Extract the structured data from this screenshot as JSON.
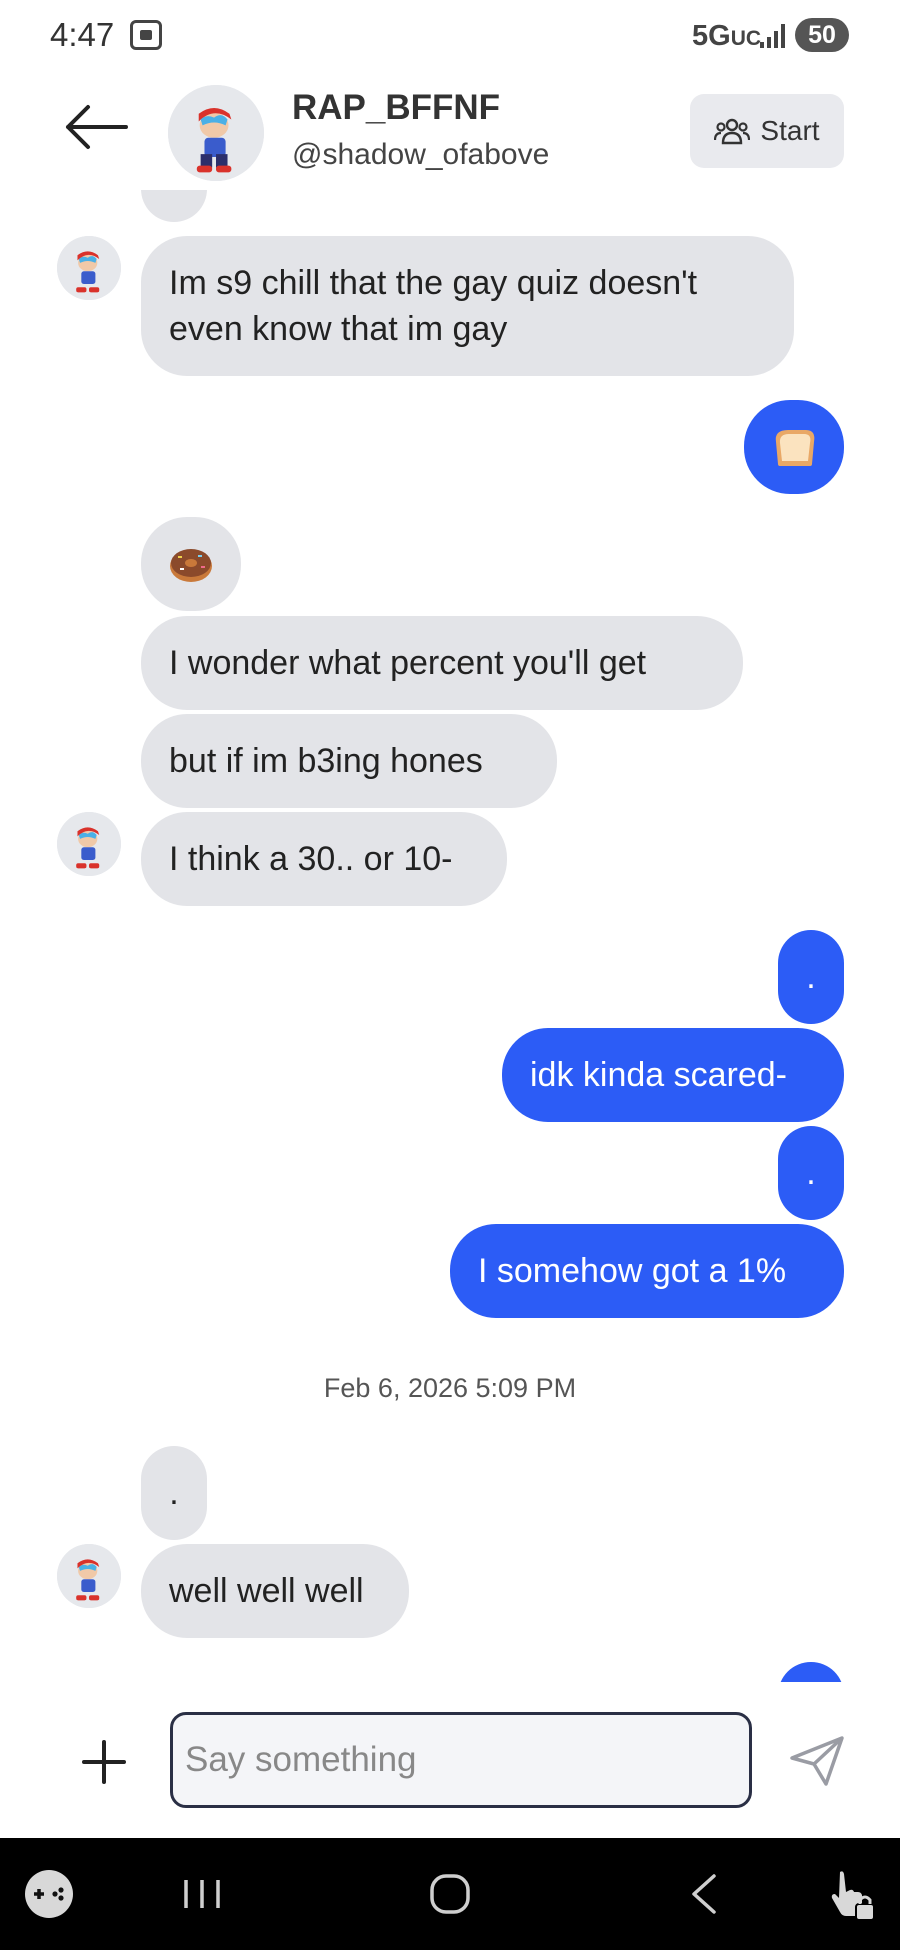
{
  "status_bar": {
    "time": "4:47",
    "network": "5G",
    "network_suffix": "UC",
    "battery": "50"
  },
  "header": {
    "name": "RAP_BFFNF",
    "handle": "@shadow_ofabove",
    "start_label": "Start"
  },
  "messages": {
    "m1": "Im s9 chill that the gay quiz doesn't",
    "m1b": "even know that im gay",
    "m3": "I wonder what percent you'll get",
    "m4": "but if im b3ing hones",
    "m5": "I think a 30.. or 10-",
    "m6": ".",
    "m7": "idk kinda scared-",
    "m8": ".",
    "m9": "I somehow got a 1%",
    "m10": ".",
    "m11": "well well well"
  },
  "timestamp": "Feb 6, 2026 5:09 PM",
  "composer": {
    "placeholder": "Say something"
  },
  "colors": {
    "outgoing": "#2c5cf6",
    "incoming": "#e3e4e8"
  }
}
